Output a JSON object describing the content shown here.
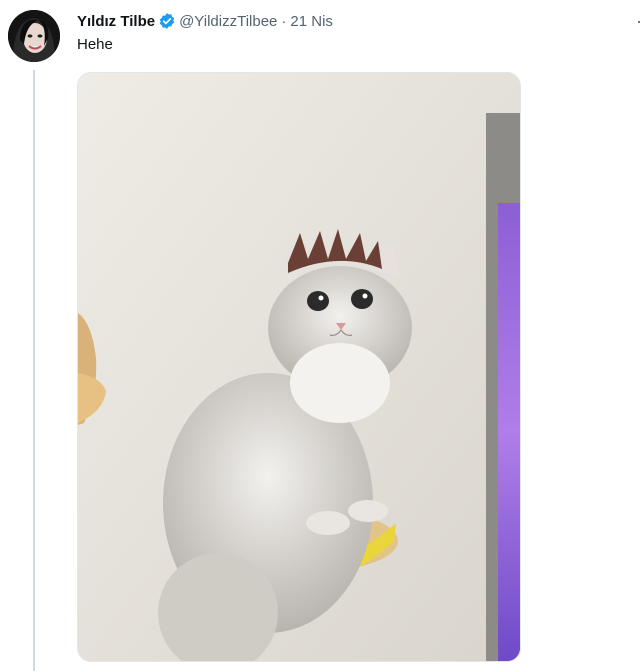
{
  "tweet": {
    "author": {
      "display_name": "Yıldız Tilbe",
      "handle": "@YildizzTilbee",
      "verified": true,
      "verified_color": "#1d9bf0"
    },
    "separator": "·",
    "date": "21 Nis",
    "text": "Hehe",
    "more_icon": "more-options-icon",
    "media": {
      "kind": "photo"
    }
  }
}
